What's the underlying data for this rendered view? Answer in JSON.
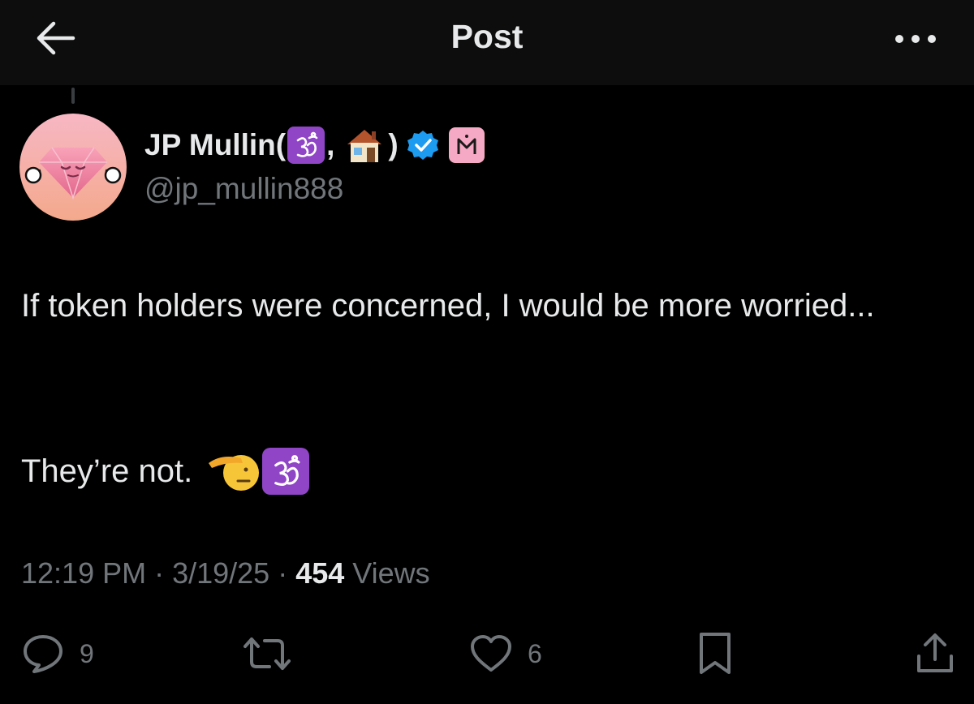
{
  "header": {
    "title": "Post",
    "back_icon": "arrow-left-icon",
    "more_icon": "more-horizontal-icon"
  },
  "author": {
    "display_name": "JP Mullin",
    "name_open": " (",
    "name_comma": ",",
    "name_close": ")",
    "name_emojis": [
      "om-emoji",
      "house-emoji"
    ],
    "handle": "@jp_mullin888",
    "verified": true,
    "verified_color": "#1d9bf0",
    "affiliate_badge_icon": "m-badge-icon"
  },
  "post": {
    "text_line1": "If token holders were concerned, I would be more worried...",
    "text_line2": "They’re not.",
    "trailing_emojis": [
      "saluting-face-emoji",
      "om-emoji"
    ]
  },
  "meta": {
    "time": "12:19 PM",
    "separator": " · ",
    "date": "3/19/25",
    "views_count": "454",
    "views_label": " Views"
  },
  "actions": {
    "reply": {
      "icon": "reply-icon",
      "count": "9"
    },
    "repost": {
      "icon": "repost-icon",
      "count": ""
    },
    "like": {
      "icon": "heart-icon",
      "count": "6"
    },
    "bookmark": {
      "icon": "bookmark-icon"
    },
    "share": {
      "icon": "share-icon"
    }
  },
  "colors": {
    "background": "#000000",
    "header_background": "#0d0d0d",
    "text_primary": "#e7e9ea",
    "text_secondary": "#71767b",
    "om_badge": "#8f45c6",
    "affiliate_badge": "#f6a9c4"
  }
}
